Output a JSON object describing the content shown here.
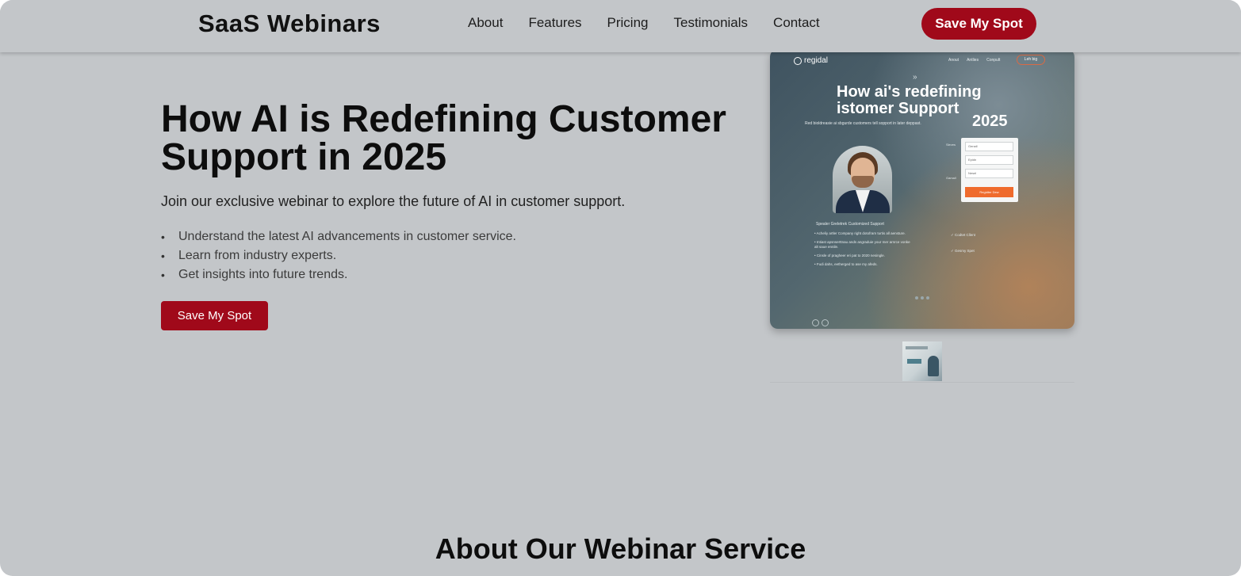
{
  "header": {
    "brand": "SaaS Webinars",
    "nav": [
      "About",
      "Features",
      "Pricing",
      "Testimonials",
      "Contact"
    ],
    "cta_label": "Save My Spot"
  },
  "hero": {
    "title": "How AI is Redefining Customer Support in 2025",
    "subtitle": "Join our exclusive webinar to explore the future of AI in customer support.",
    "bullets": [
      "Understand the latest AI advancements in customer service.",
      "Learn from industry experts.",
      "Get insights into future trends."
    ],
    "cta_label": "Save My Spot"
  },
  "preview": {
    "logo": "regidal",
    "nav": [
      "Anout",
      "Antlies",
      "Conpult"
    ],
    "pill": "Leh big",
    "chevron": "»",
    "title": "How ai's redefining istomer Support",
    "year": "2025",
    "subtitle": "Red bioldreasie ai sbgurde customers tell sopport in later deppast.",
    "form_labels": [
      "Sleves",
      "Gamall"
    ],
    "form_fields": [
      "Genall",
      "Epidn",
      "Nesel"
    ],
    "form_button": "Regidter Dew",
    "list_head": "Spealer Greletrek Customized Support",
    "list": [
      "Acheliy artler Company right dotofram turtis all aensture.",
      "Intiast apsnserttnau ands angraduie your mer arnrce vonke alt saue ennile.",
      "Cinsle of pragheer eri pat to 2020 nesingle.",
      "Fudi dahs, eetherged to ase my afeds."
    ],
    "checks": [
      "Codtet Cllent",
      "Gesmy Spet"
    ]
  },
  "about": {
    "title": "About Our Webinar Service"
  },
  "colors": {
    "background": "#c3c6c9",
    "accent": "#a0091a",
    "form_button": "#ef6b2d"
  }
}
